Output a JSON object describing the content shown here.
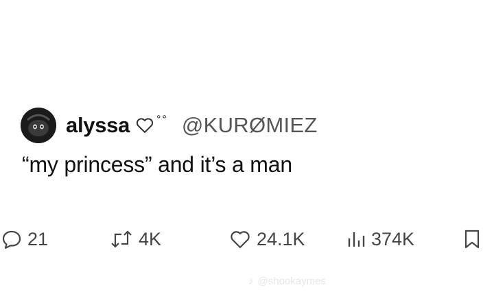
{
  "post": {
    "author_name": "alyssa",
    "author_handle": "@KURØMIEZ",
    "name_decoration": "°°",
    "text": "“my princess” and it’s a man",
    "replies": "21",
    "reposts": "4K",
    "likes": "24.1K",
    "views": "374K"
  },
  "icons": {
    "reply": "reply-bubble-icon",
    "repost": "repost-arrows-icon",
    "like": "heart-icon",
    "views": "views-bar-chart-icon",
    "bookmark": "bookmark-icon",
    "decoration": "heart-outline-icon"
  },
  "watermark": {
    "text": "@shookaymes"
  },
  "colors": {
    "background": "#ffffff",
    "text": "#111111",
    "secondary": "#555555"
  }
}
